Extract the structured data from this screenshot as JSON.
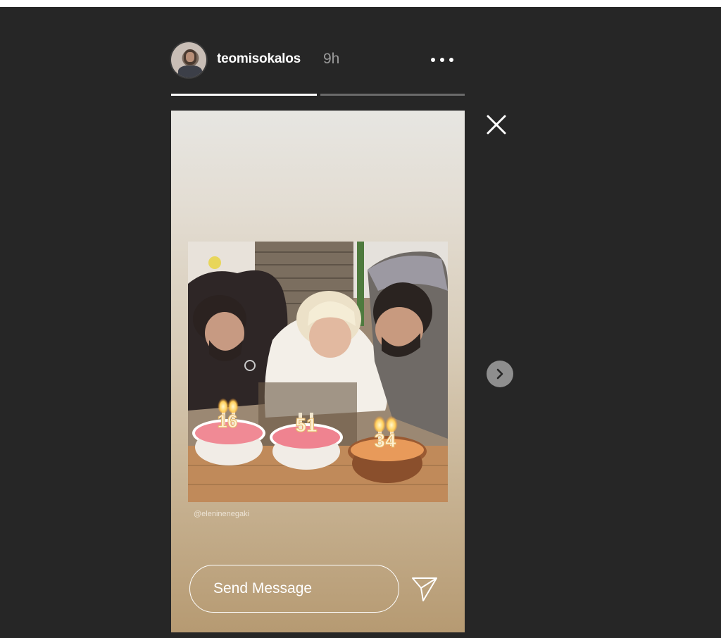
{
  "story": {
    "username": "teomisokalos",
    "timestamp": "9h",
    "progress": [
      1.0,
      0.0
    ],
    "photo_credit": "@eleninenegaki",
    "candles": [
      "16",
      "51",
      "34"
    ]
  },
  "reply": {
    "placeholder": "Send Message"
  },
  "icons": {
    "more": "more-options-icon",
    "close": "close-icon",
    "next": "chevron-right-icon",
    "send": "paper-plane-icon"
  },
  "colors": {
    "background": "#262626",
    "text": "#ffffff",
    "muted": "#9b9b9b"
  }
}
